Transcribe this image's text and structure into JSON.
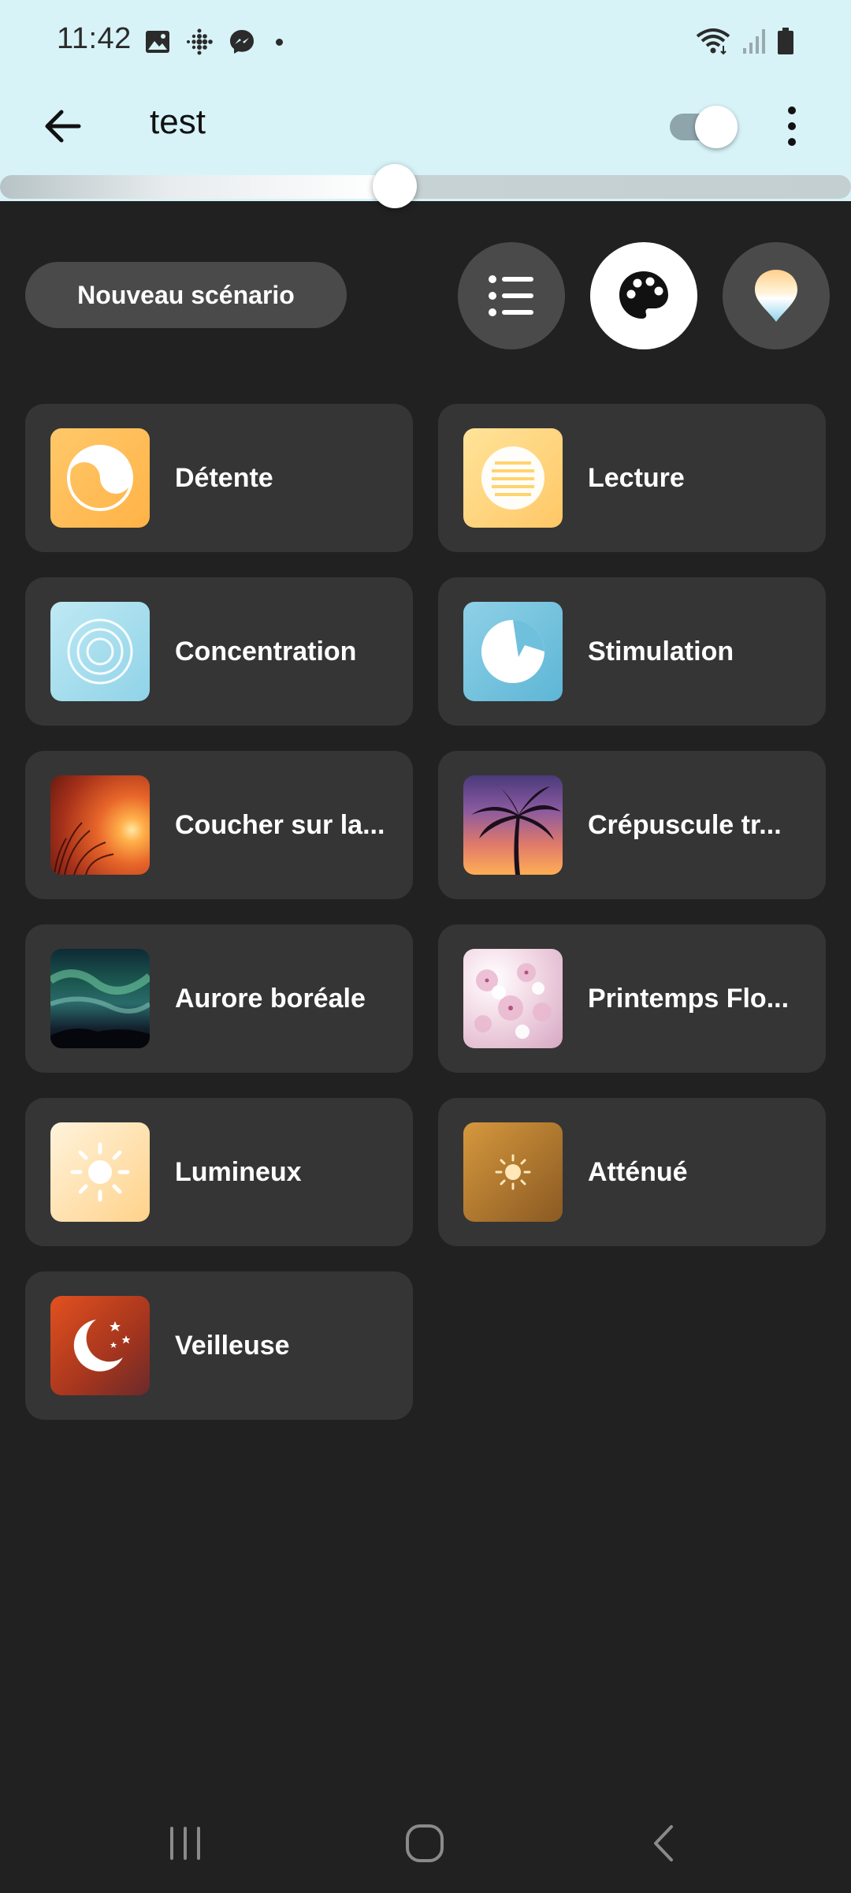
{
  "status_bar": {
    "time": "11:42",
    "left_icons": [
      "gallery-icon",
      "fitbit-icon",
      "messenger-icon",
      "notification-dot-icon"
    ],
    "right_icons": [
      "wifi-icon",
      "signal-icon",
      "battery-icon"
    ]
  },
  "app_bar": {
    "title": "test",
    "power_toggle_on": true,
    "brightness_level": 0.46
  },
  "actions": {
    "new_scene_label": "Nouveau scénario",
    "view_buttons": [
      {
        "icon": "list-icon",
        "active": false
      },
      {
        "icon": "palette-icon",
        "active": true
      },
      {
        "icon": "color-picker-icon",
        "active": false
      }
    ]
  },
  "scenes": [
    {
      "label": "Détente",
      "icon": "yin-yang-icon"
    },
    {
      "label": "Lecture",
      "icon": "lines-icon"
    },
    {
      "label": "Concentration",
      "icon": "concentric-circles-icon"
    },
    {
      "label": "Stimulation",
      "icon": "lightning-circle-icon"
    },
    {
      "label": "Coucher sur la...",
      "icon": "sunset-photo"
    },
    {
      "label": "Crépuscule tr...",
      "icon": "palm-tree-photo"
    },
    {
      "label": "Aurore boréale",
      "icon": "aurora-photo"
    },
    {
      "label": "Printemps Flo...",
      "icon": "cherry-blossom-photo"
    },
    {
      "label": "Lumineux",
      "icon": "bright-sun-icon"
    },
    {
      "label": "Atténué",
      "icon": "dim-sun-icon"
    },
    {
      "label": "Veilleuse",
      "icon": "moon-stars-icon"
    }
  ],
  "colors": {
    "header_bg": "#d7f3f8",
    "page_bg": "#212121",
    "card_bg": "#353535",
    "button_bg": "#4a4a4a"
  },
  "nav_bar": [
    "recents-icon",
    "home-icon",
    "back-icon"
  ]
}
